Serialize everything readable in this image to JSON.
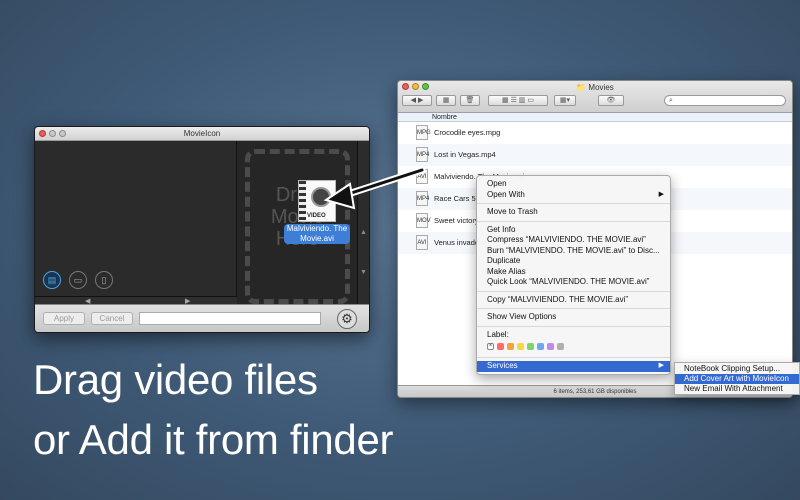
{
  "movieicon_window": {
    "title": "MovieIcon",
    "drop_zone_text": [
      "Drag",
      "Movie",
      "Here"
    ],
    "toolbar": {
      "apply_label": "Apply",
      "cancel_label": "Cancel",
      "path_value": ""
    }
  },
  "dragged_file": {
    "badge": "VIDEO",
    "label_line1": "Malviviendo. The",
    "label_line2": "Movie.avi"
  },
  "finder_window": {
    "title": "Movies",
    "search_placeholder": "",
    "column_header": "Nombre",
    "files": [
      {
        "name": "Crocodile eyes.mpg",
        "icon": "MPG"
      },
      {
        "name": "Lost in Vegas.mp4",
        "icon": "MP4"
      },
      {
        "name": "Malviviendo. The Movie.avi",
        "icon": "AVI"
      },
      {
        "name": "Race Cars 5.mp4",
        "icon": "MP4"
      },
      {
        "name": "Sweet victory",
        "icon": "MOV"
      },
      {
        "name": "Venus invaders",
        "icon": "AVI"
      }
    ],
    "status": "6 items, 253,61 GB disponibles"
  },
  "context_menu": {
    "items": [
      "Open",
      "Open With",
      "Move to Trash",
      "Get Info",
      "Compress “MALVIVIENDO. THE MOVIE.avi”",
      "Burn “MALVIVIENDO. THE MOVIE.avi” to Disc...",
      "Duplicate",
      "Make Alias",
      "Quick Look “MALVIVIENDO. THE MOVIE.avi”",
      "Copy “MALVIVIENDO. THE MOVIE.avi”",
      "Show View Options",
      "Label:",
      "Services"
    ],
    "label_colors": [
      "#ff6b6b",
      "#f7a23b",
      "#f4d84a",
      "#7ed36b",
      "#6fa8ef",
      "#c18ae6",
      "#b0b0b0"
    ]
  },
  "services_submenu": {
    "items": [
      "NoteBook Clipping Setup...",
      "Add Cover Art with MovieIcon",
      "New Email With Attachment"
    ]
  },
  "caption": {
    "line1": "Drag video files",
    "line2": "or Add it from finder"
  }
}
